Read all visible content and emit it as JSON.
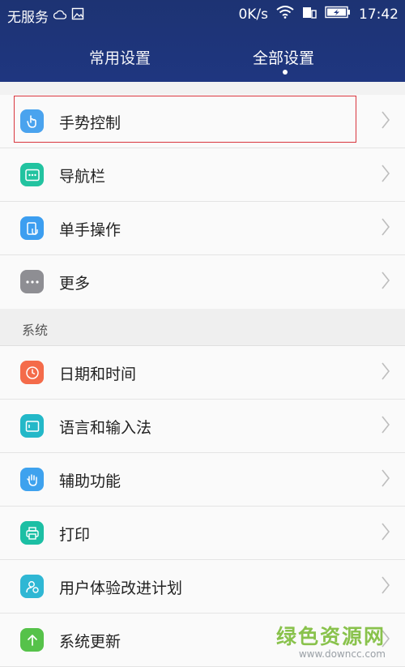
{
  "status_bar": {
    "carrier": "无服务",
    "speed": "0K/s",
    "time": "17:42",
    "icons": [
      "cloud-icon",
      "image-icon",
      "wifi-icon",
      "sim-icon",
      "battery-icon"
    ]
  },
  "tabs": [
    {
      "label": "常用设置",
      "selected": false
    },
    {
      "label": "全部设置",
      "selected": true
    }
  ],
  "items_top": [
    {
      "label": "手势控制",
      "icon": "gesture-icon",
      "color": "#4aa3ee"
    },
    {
      "label": "导航栏",
      "icon": "navbar-icon",
      "color": "#22c3a0"
    },
    {
      "label": "单手操作",
      "icon": "one-hand-icon",
      "color": "#3c9ef0"
    },
    {
      "label": "更多",
      "icon": "more-icon",
      "color": "#8e8e93"
    }
  ],
  "section_system": "系统",
  "items_system": [
    {
      "label": "日期和时间",
      "icon": "clock-icon",
      "color": "#f46b4a"
    },
    {
      "label": "语言和输入法",
      "icon": "keyboard-icon",
      "color": "#23b8c8"
    },
    {
      "label": "辅助功能",
      "icon": "hand-icon",
      "color": "#3ea2ee"
    },
    {
      "label": "打印",
      "icon": "printer-icon",
      "color": "#1cbfa4"
    },
    {
      "label": "用户体验改进计划",
      "icon": "user-experience-icon",
      "color": "#2fb7d4"
    },
    {
      "label": "系统更新",
      "icon": "update-icon",
      "color": "#56c24a"
    }
  ],
  "watermark": {
    "main": "绿色资源网",
    "sub": "www.downcc.com"
  },
  "colors": {
    "header": "#1f3680",
    "highlight": "#d9363e"
  }
}
